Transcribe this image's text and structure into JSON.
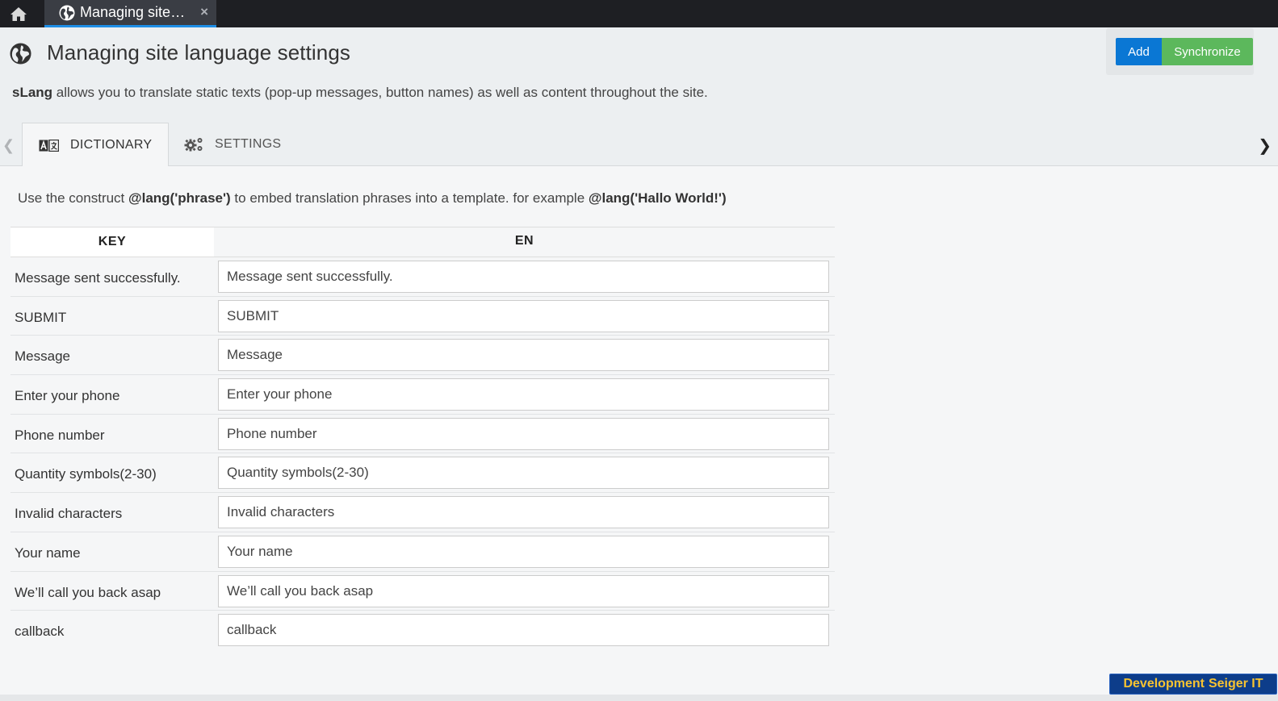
{
  "topbar": {
    "home_icon": "home-icon",
    "tab": {
      "title": "Managing site…",
      "icon": "globe-icon",
      "close": "×"
    }
  },
  "header": {
    "title": "Managing site language settings",
    "icon": "globe-icon",
    "description_bold": "sLang",
    "description_rest": " allows you to translate static texts (pop-up messages, button names) as well as content throughout the site."
  },
  "actions": {
    "add_label": "Add",
    "sync_label": "Synchronize"
  },
  "tabs": [
    {
      "label": "DICTIONARY",
      "icon": "dictionary-icon",
      "active": true
    },
    {
      "label": "SETTINGS",
      "icon": "gears-icon",
      "active": false
    }
  ],
  "info": {
    "part1": "Use the construct ",
    "code1": "@lang('phrase')",
    "part2": " to embed translation phrases into a template. for example ",
    "code2": "@lang('Hallo World!')"
  },
  "table": {
    "headers": {
      "key": "KEY",
      "en": "EN"
    },
    "rows": [
      {
        "key": "Message sent successfully.",
        "en": "Message sent successfully."
      },
      {
        "key": "SUBMIT",
        "en": "SUBMIT"
      },
      {
        "key": "Message",
        "en": "Message"
      },
      {
        "key": "Enter your phone",
        "en": "Enter your phone"
      },
      {
        "key": "Phone number",
        "en": "Phone number"
      },
      {
        "key": "Quantity symbols(2-30)",
        "en": "Quantity symbols(2-30)"
      },
      {
        "key": "Invalid characters",
        "en": "Invalid characters"
      },
      {
        "key": "Your name",
        "en": "Your name"
      },
      {
        "key": "We’ll call you back asap",
        "en": "We’ll call you back asap"
      },
      {
        "key": "callback",
        "en": "callback"
      }
    ]
  },
  "badge": {
    "part1": "Development",
    "part2": "Seiger IT"
  },
  "colors": {
    "add": "#0a77d4",
    "sync": "#5cb85c",
    "topbar": "#1e1f23",
    "tab_underline": "#1e8ee6"
  }
}
